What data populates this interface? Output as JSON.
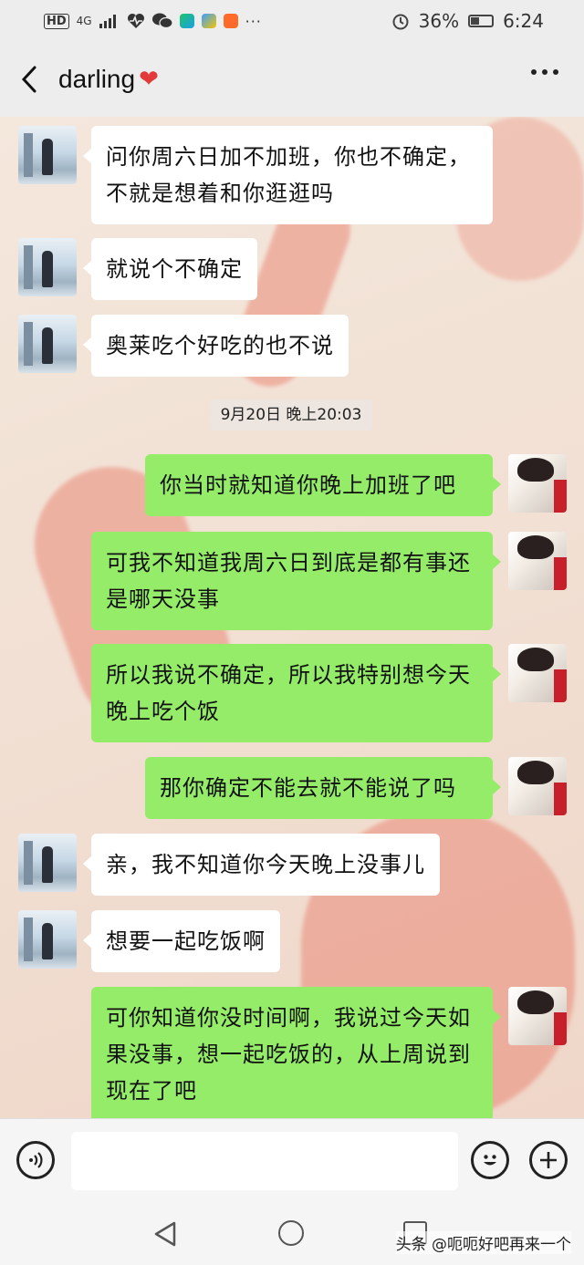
{
  "status_bar": {
    "network": "HD",
    "signal": "4G",
    "battery": "36%",
    "time": "6:24"
  },
  "header": {
    "title": "darling",
    "title_emoji": "❤"
  },
  "timestamp": "9月20日 晚上20:03",
  "messages": [
    {
      "side": "left",
      "text": "问你周六日加不加班，你也不确定，不就是想着和你逛逛吗"
    },
    {
      "side": "left",
      "text": "就说个不确定"
    },
    {
      "side": "left",
      "text": "奥莱吃个好吃的也不说"
    },
    {
      "side": "right",
      "text": "你当时就知道你晚上加班了吧"
    },
    {
      "side": "right",
      "text": "可我不知道我周六日到底是都有事还是哪天没事"
    },
    {
      "side": "right",
      "text": "所以我说不确定，所以我特别想今天晚上吃个饭"
    },
    {
      "side": "right",
      "text": "那你确定不能去就不能说了吗"
    },
    {
      "side": "left",
      "text": "亲，我不知道你今天晚上没事儿"
    },
    {
      "side": "left",
      "text": "想要一起吃饭啊"
    },
    {
      "side": "right",
      "text": "可你知道你没时间啊，我说过今天如果没事，想一起吃饭的，从上周说到现在了吧"
    }
  ],
  "input": {
    "value": ""
  },
  "watermark": "头条 @呃呃好吧再来一个",
  "colors": {
    "my_bubble": "#95ec69",
    "friend_bubble": "#ffffff",
    "accent_heart": "#e23a3a"
  }
}
